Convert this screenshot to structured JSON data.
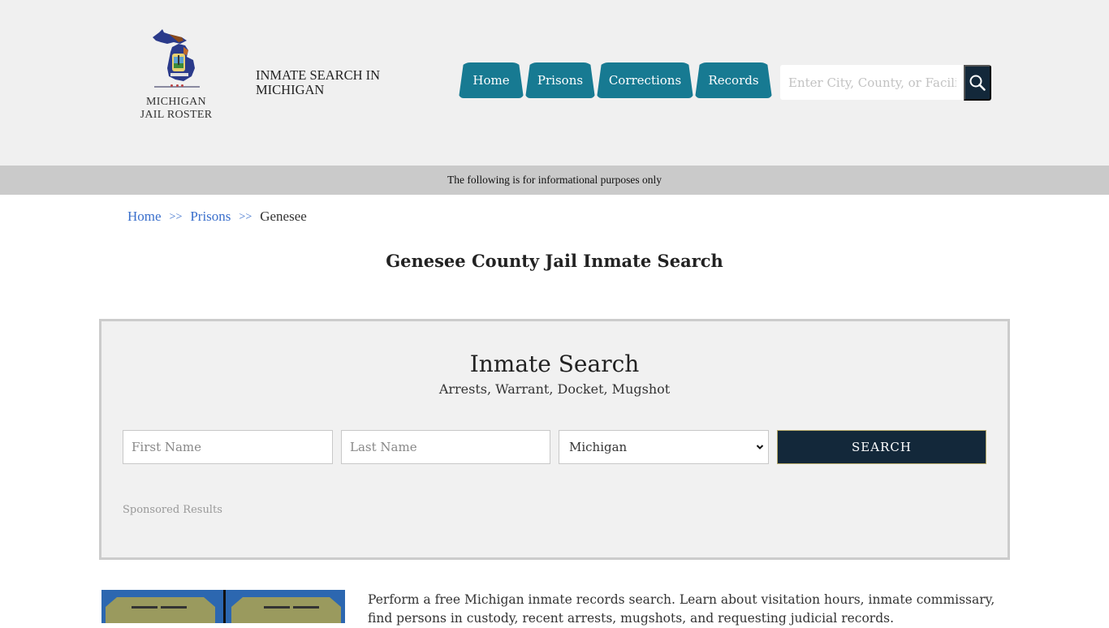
{
  "header": {
    "logo_line1": "MICHIGAN",
    "logo_line2": "JAIL ROSTER",
    "site_title": "INMATE SEARCH IN MICHIGAN",
    "nav": [
      {
        "label": "Home"
      },
      {
        "label": "Prisons"
      },
      {
        "label": "Corrections"
      },
      {
        "label": "Records"
      }
    ],
    "search_placeholder": "Enter City, County, or Facility",
    "search_icon": "magnifier-icon"
  },
  "info_bar": "The following is for informational purposes only",
  "breadcrumb": {
    "items": [
      {
        "label": "Home"
      },
      {
        "label": "Prisons"
      }
    ],
    "separator": ">>",
    "current": "Genesee"
  },
  "page_title": "Genesee County Jail Inmate Search",
  "search_panel": {
    "title": "Inmate Search",
    "subtitle": "Arrests, Warrant, Docket, Mugshot",
    "first_name_placeholder": "First Name",
    "last_name_placeholder": "Last Name",
    "state_selected": "Michigan",
    "submit_label": "SEARCH",
    "sponsored_label": "Sponsored Results"
  },
  "intro_text": "Perform a free Michigan inmate records search. Learn about visitation hours, inmate commissary, find persons in custody, recent arrests, mugshots, and requesting judicial records.",
  "colors": {
    "nav_bg": "#177a92",
    "dark_navy": "#13283a",
    "link_blue": "#3a6fcc",
    "info_bar_bg": "#cacaca",
    "header_bg": "#f0f0f0"
  }
}
